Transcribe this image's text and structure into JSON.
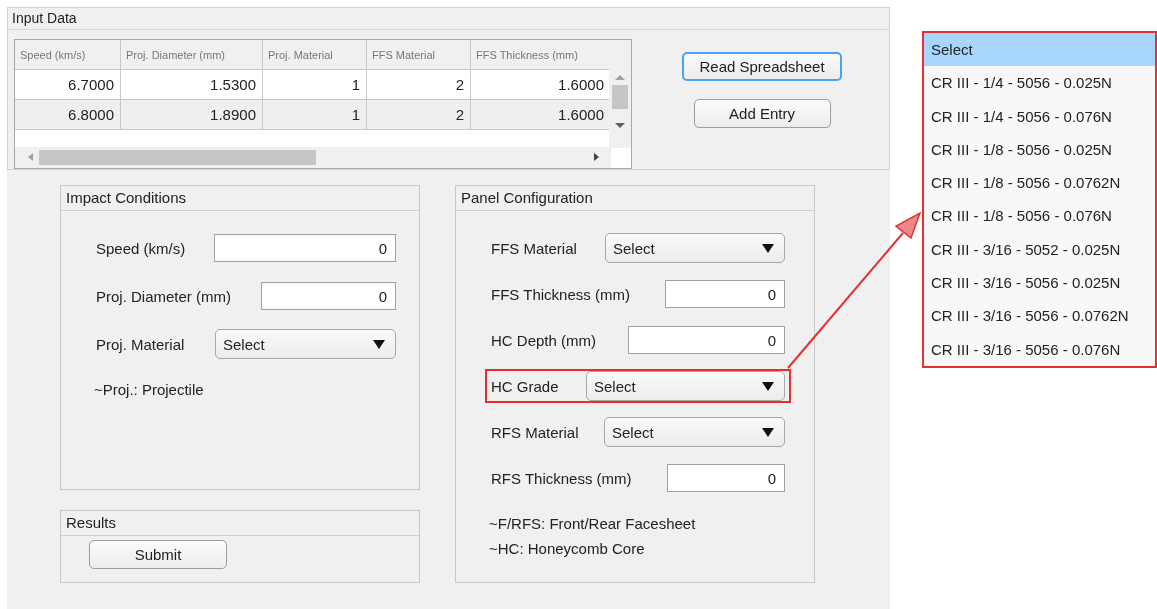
{
  "input_data": {
    "title": "Input Data",
    "table": {
      "columns": [
        "Speed (km/s)",
        "Proj. Diameter (mm)",
        "Proj. Material",
        "FFS Material",
        "FFS Thickness (mm)"
      ],
      "rows": [
        [
          "6.7000",
          "1.5300",
          "1",
          "2",
          "1.6000"
        ],
        [
          "6.8000",
          "1.8900",
          "1",
          "2",
          "1.6000"
        ]
      ]
    },
    "buttons": [
      {
        "label": "Read Spreadsheet",
        "focused": true
      },
      {
        "label": "Add Entry",
        "focused": false
      }
    ]
  },
  "impact_conditions": {
    "title": "Impact Conditions",
    "fields": [
      {
        "kind": "input",
        "label": "Speed (km/s)",
        "value": "0"
      },
      {
        "kind": "input",
        "label": "Proj. Diameter (mm)",
        "value": "0"
      },
      {
        "kind": "select",
        "label": "Proj. Material",
        "value": "Select"
      }
    ],
    "note": "~Proj.: Projectile"
  },
  "results": {
    "title": "Results",
    "button": "Submit"
  },
  "panel_configuration": {
    "title": "Panel Configuration",
    "fields": [
      {
        "kind": "select",
        "label": "FFS Material",
        "value": "Select",
        "highlighted": false
      },
      {
        "kind": "input",
        "label": "FFS Thickness (mm)",
        "value": "0",
        "highlighted": false
      },
      {
        "kind": "input",
        "label": "HC Depth (mm)",
        "value": "0",
        "highlighted": false
      },
      {
        "kind": "select",
        "label": "HC Grade",
        "value": "Select",
        "highlighted": true
      },
      {
        "kind": "select",
        "label": "RFS Material",
        "value": "Select",
        "highlighted": false
      },
      {
        "kind": "input",
        "label": "RFS Thickness (mm)",
        "value": "0",
        "highlighted": false
      }
    ],
    "notes": [
      "~F/RFS: Front/Rear Facesheet",
      "~HC: Honeycomb Core"
    ]
  },
  "dropdown_list": {
    "items": [
      {
        "label": "Select",
        "selected": true
      },
      {
        "label": "CR III - 1/4 - 5056 - 0.025N",
        "selected": false
      },
      {
        "label": "CR III - 1/4 - 5056 - 0.076N",
        "selected": false
      },
      {
        "label": "CR III - 1/8 - 5056 - 0.025N",
        "selected": false
      },
      {
        "label": "CR III - 1/8 - 5056 - 0.0762N",
        "selected": false
      },
      {
        "label": "CR III - 1/8 - 5056 - 0.076N",
        "selected": false
      },
      {
        "label": "CR III - 3/16 - 5052 - 0.025N",
        "selected": false
      },
      {
        "label": "CR III - 3/16 - 5056 - 0.025N",
        "selected": false
      },
      {
        "label": "CR III - 3/16 - 5056 - 0.0762N",
        "selected": false
      },
      {
        "label": "CR III - 3/16 - 5056 - 0.076N",
        "selected": false
      }
    ]
  }
}
